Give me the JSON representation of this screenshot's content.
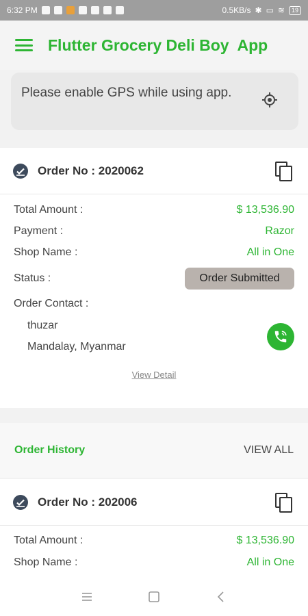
{
  "status_bar": {
    "time": "6:32 PM",
    "speed": "0.5KB/s",
    "battery": "19"
  },
  "app_bar": {
    "title": "Flutter Grocery Deli Boy  App"
  },
  "gps_notice": {
    "message": "Please enable GPS while using app."
  },
  "current_order": {
    "order_no": "Order No : 2020062",
    "total_amount_label": "Total Amount  :",
    "total_amount": "$ 13,536.90",
    "payment_label": "Payment :",
    "payment": "Razor",
    "shop_name_label": "Shop Name :",
    "shop_name": "All in One",
    "status_label": "Status :",
    "status": "Order Submitted",
    "contact_label": "Order Contact :",
    "contact_name": "thuzar",
    "contact_address": "Mandalay, Myanmar",
    "view_detail": "View Detail"
  },
  "history": {
    "title": "Order History",
    "view_all": "VIEW ALL"
  },
  "history_order": {
    "order_no": "Order No : 202006",
    "total_amount_label": "Total Amount  :",
    "total_amount": "$ 13,536.90",
    "shop_name_label": "Shop Name :",
    "shop_name": "All in One"
  },
  "colors": {
    "accent": "#2db533",
    "status_badge": "#b9b2ad"
  },
  "icons": {
    "menu": "hamburger-menu-icon",
    "gps": "gps-target-icon",
    "check": "check-circle-icon",
    "copy": "copy-icon",
    "phone": "phone-icon",
    "nav_recent": "recents-icon",
    "nav_home": "home-square-icon",
    "nav_back": "back-chevron-icon"
  }
}
